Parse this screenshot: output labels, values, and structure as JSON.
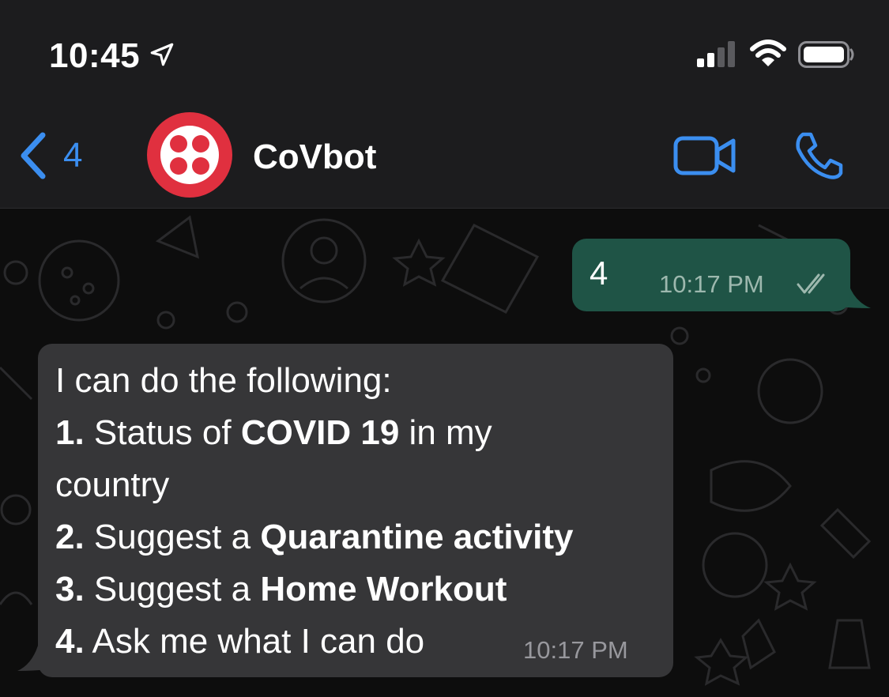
{
  "status_bar": {
    "time": "10:45",
    "icons": [
      "location-arrow-icon",
      "cellular-signal-icon",
      "wifi-icon",
      "battery-icon"
    ]
  },
  "header": {
    "back_count": "4",
    "contact_name": "CoVbot",
    "icons": [
      "back-chevron-icon",
      "avatar-logo",
      "video-camera-icon",
      "phone-icon"
    ],
    "accent_color": "#3b8ef0",
    "avatar_color": "#e0303f"
  },
  "messages": [
    {
      "direction": "outgoing",
      "text": "4",
      "time": "10:17 PM",
      "status": "read-ticks-icon"
    },
    {
      "direction": "incoming",
      "lines": [
        {
          "segments": [
            {
              "text": "I can do the following:",
              "bold": false
            }
          ]
        },
        {
          "segments": [
            {
              "text": "1.",
              "bold": true
            },
            {
              "text": " Status of ",
              "bold": false
            },
            {
              "text": "COVID 19",
              "bold": true
            },
            {
              "text": " in my",
              "bold": false
            }
          ]
        },
        {
          "segments": [
            {
              "text": "country",
              "bold": false
            }
          ]
        },
        {
          "segments": [
            {
              "text": "2.",
              "bold": true
            },
            {
              "text": " Suggest a ",
              "bold": false
            },
            {
              "text": "Quarantine activity",
              "bold": true
            }
          ]
        },
        {
          "segments": [
            {
              "text": "3.",
              "bold": true
            },
            {
              "text": " Suggest a ",
              "bold": false
            },
            {
              "text": "Home Workout",
              "bold": true
            }
          ]
        },
        {
          "segments": [
            {
              "text": "4.",
              "bold": true
            },
            {
              "text": " Ask me what I can do",
              "bold": false
            }
          ]
        }
      ],
      "time": "10:17 PM"
    }
  ],
  "colors": {
    "outgoing_bubble": "#1f5446",
    "incoming_bubble": "#363638",
    "bar_background": "#1c1c1e"
  }
}
